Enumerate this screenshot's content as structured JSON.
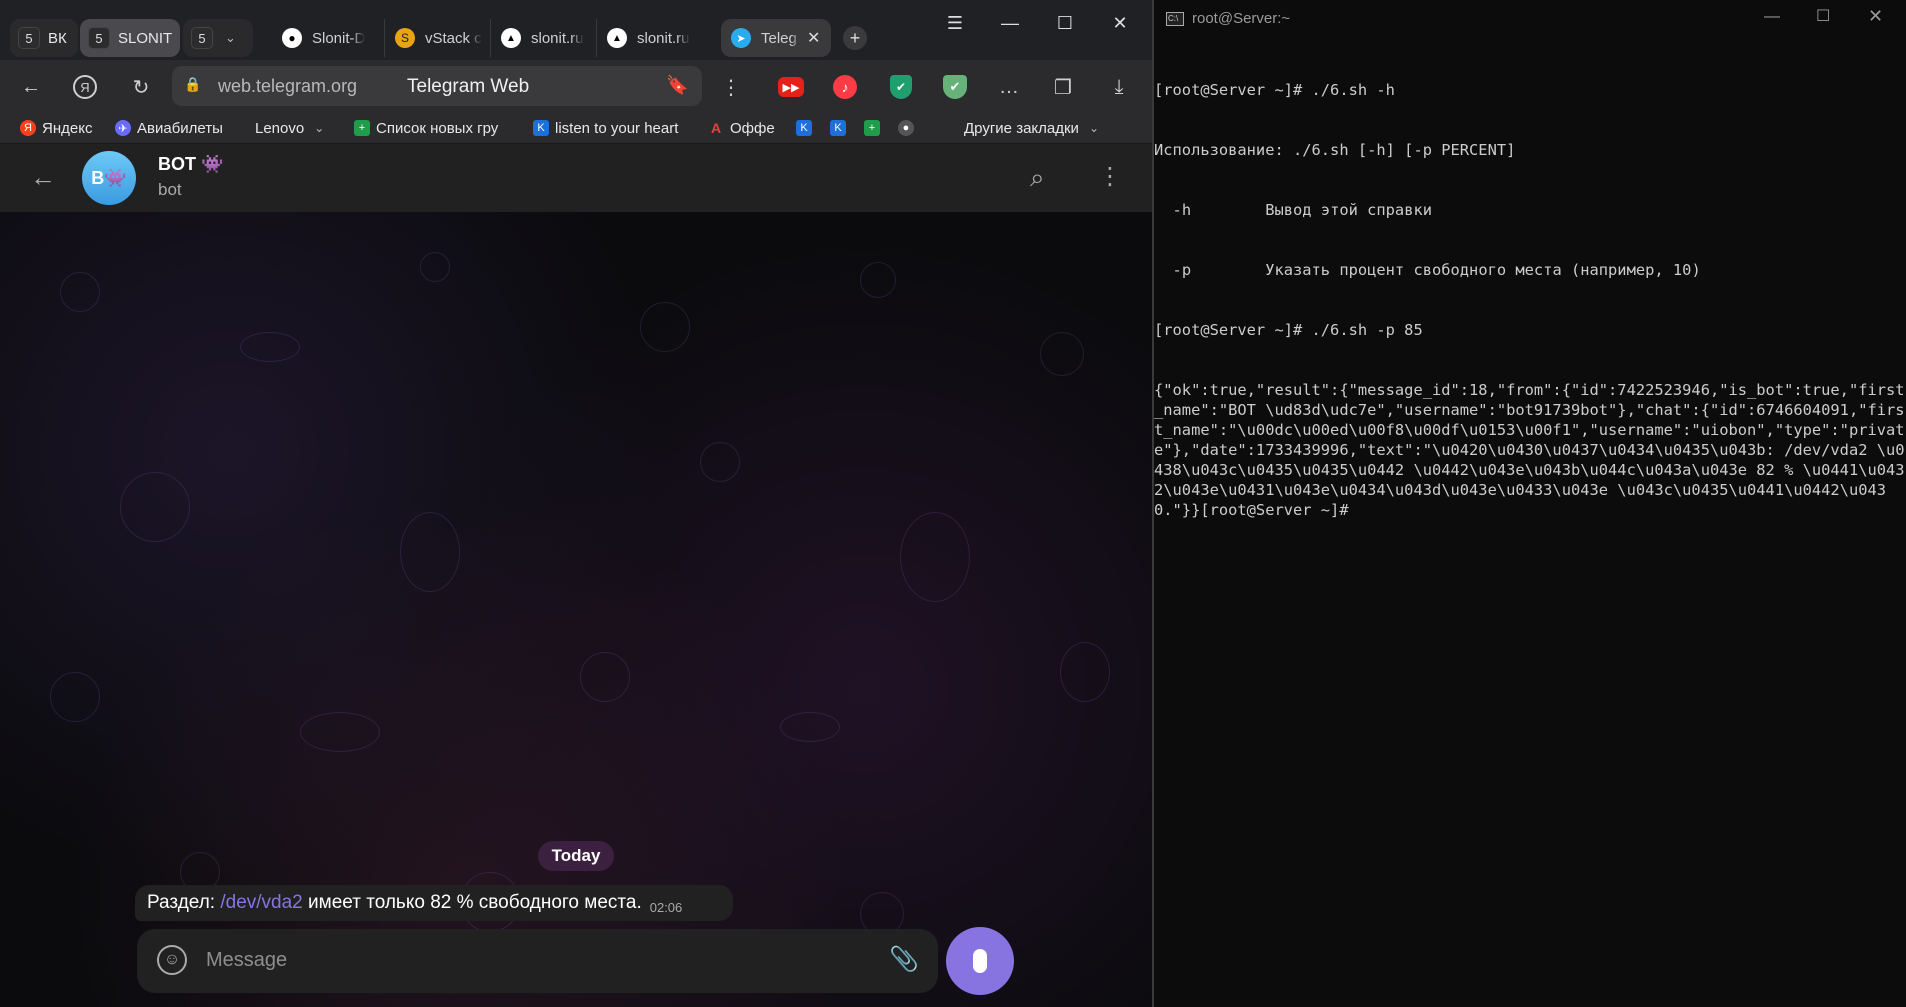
{
  "browser": {
    "tab_groups": [
      {
        "count": "5",
        "label": "ВК"
      },
      {
        "count": "5",
        "label": "SLONIT"
      },
      {
        "count": "5",
        "label": ""
      }
    ],
    "tabs": [
      {
        "label": "Slonit-D",
        "icon": "github-icon"
      },
      {
        "label": "vStack c",
        "icon": "vstack-icon"
      },
      {
        "label": "slonit.ru",
        "icon": "triangle-icon"
      },
      {
        "label": "slonit.ru",
        "icon": "triangle-icon"
      },
      {
        "label": "Teleg",
        "icon": "telegram-icon",
        "active": true
      }
    ],
    "url_domain": "web.telegram.org",
    "page_title": "Telegram Web",
    "bookmarks": [
      {
        "label": "Яндекс",
        "icon_color": "#fc3f1d",
        "glyph": "Я"
      },
      {
        "label": "Авиабилеты",
        "icon_color": "#6b6bff",
        "glyph": "✈"
      },
      {
        "label": "Lenovo",
        "icon_color": "",
        "glyph": ""
      },
      {
        "label": "Список новых гру",
        "icon_color": "#1e9e4a",
        "glyph": "+"
      },
      {
        "label": "listen to your heart",
        "icon_color": "#1e6fdc",
        "glyph": "K"
      },
      {
        "label": "Оффе",
        "icon_color": "#e8423a",
        "glyph": "A"
      }
    ],
    "other_bookmarks": "Другие закладки"
  },
  "chat": {
    "name": "BOT 👾",
    "status": "bot",
    "avatar_text": "B👾",
    "date_separator": "Today",
    "message": {
      "prefix": "Раздел: ",
      "link": "/dev/vda2",
      "suffix": " имеет только 82 % свободного места.",
      "time": "02:06"
    },
    "composer_placeholder": "Message"
  },
  "terminal": {
    "title": "root@Server:~",
    "lines": [
      "[root@Server ~]# ./6.sh -h",
      "Использование: ./6.sh [-h] [-p PERCENT]",
      "  -h        Вывод этой справки",
      "  -p        Указать процент свободного места (например, 10)",
      "[root@Server ~]# ./6.sh -p 85",
      "{\"ok\":true,\"result\":{\"message_id\":18,\"from\":{\"id\":7422523946,\"is_bot\":true,\"first_name\":\"BOT \\ud83d\\udc7e\",\"username\":\"bot91739bot\"},\"chat\":{\"id\":6746604091,\"first_name\":\"\\u00dc\\u00ed\\u00f8\\u00df\\u0153\\u00f1\",\"username\":\"uiobon\",\"type\":\"private\"},\"date\":1733439996,\"text\":\"\\u0420\\u0430\\u0437\\u0434\\u0435\\u043b: /dev/vda2 \\u0438\\u043c\\u0435\\u0435\\u0442 \\u0442\\u043e\\u043b\\u044c\\u043a\\u043e 82 % \\u0441\\u0432\\u043e\\u0431\\u043e\\u0434\\u043d\\u043e\\u0433\\u043e \\u043c\\u0435\\u0441\\u0442\\u0430.\"}}[root@Server ~]#"
    ]
  }
}
